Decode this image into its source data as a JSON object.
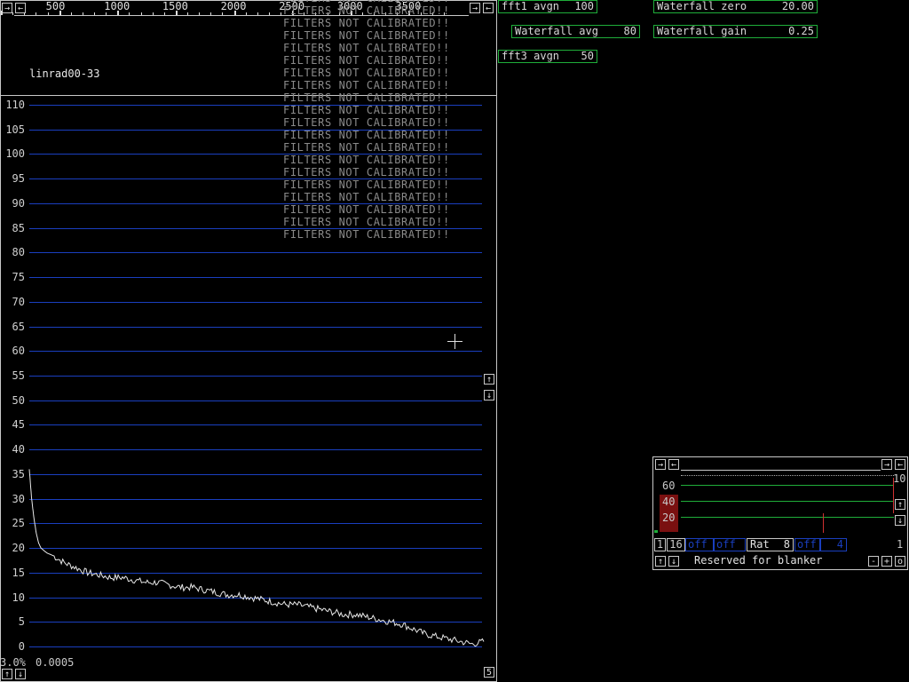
{
  "spectrum": {
    "title": "linrad00-33",
    "freq_ticks": [
      "500",
      "1000",
      "1500",
      "2000",
      "2500",
      "3000",
      "3500"
    ],
    "freq_values": [
      500,
      1000,
      1500,
      2000,
      2500,
      3000,
      3500
    ],
    "freq_range": [
      0,
      3900
    ],
    "y_ticks": [
      "110",
      "105",
      "100",
      "95",
      "90",
      "85",
      "80",
      "75",
      "70",
      "65",
      "60",
      "55",
      "50",
      "45",
      "40",
      "35",
      "30",
      "25",
      "20",
      "15",
      "10",
      "5",
      "0"
    ],
    "y_range": [
      0,
      110
    ],
    "warning_text": "FILTERS NOT CALIBRATED!!",
    "status_left": "3.0%",
    "status_value": "0.0005",
    "zoom_label": "5",
    "btn_right": "→",
    "btn_left": "←",
    "btn_up": "↑",
    "btn_down": "↓"
  },
  "params": {
    "fft1_avgn": {
      "label": "fft1 avgn",
      "value": "100"
    },
    "waterfall_avg": {
      "label": "Waterfall avg",
      "value": "80"
    },
    "fft3_avgn": {
      "label": "fft3 avgn",
      "value": "50"
    },
    "waterfall_zero": {
      "label": "Waterfall zero",
      "value": "20.00"
    },
    "waterfall_gain": {
      "label": "Waterfall gain",
      "value": "0.25"
    }
  },
  "blanker": {
    "scale": [
      "60",
      "40",
      "20"
    ],
    "top_right": "10",
    "row1": [
      "1",
      "16",
      "off",
      "off",
      "Rat",
      "8",
      "off",
      "4"
    ],
    "row1_right": "1",
    "reserved": "Reserved for blanker",
    "minus": "-",
    "plus": "+",
    "o": "o"
  },
  "chart_data": {
    "type": "line",
    "x": [
      0,
      20,
      40,
      60,
      80,
      100,
      150,
      200,
      300,
      400,
      500,
      600,
      700,
      800,
      900,
      1000,
      1100,
      1200,
      1300,
      1400,
      1500,
      1600,
      1700,
      1800,
      1900,
      2000,
      2100,
      2200,
      2300,
      2400,
      2500,
      2600,
      2700,
      2800,
      2900,
      3000,
      3100,
      3200,
      3300,
      3400,
      3500,
      3600,
      3700,
      3800,
      3900
    ],
    "y": [
      36,
      30,
      26,
      23,
      21,
      20,
      19,
      18.5,
      17,
      16,
      15,
      14.5,
      14,
      14,
      13.5,
      13,
      13,
      12.5,
      12,
      12,
      11.5,
      11,
      10.5,
      10.5,
      10,
      9.5,
      9,
      8.5,
      8.5,
      8,
      7.5,
      7,
      6.5,
      6.5,
      6,
      5.5,
      5,
      4.5,
      3.5,
      2.5,
      2,
      1.5,
      1,
      0.5,
      1
    ],
    "xlim": [
      0,
      3900
    ],
    "ylim": [
      0,
      110
    ]
  }
}
